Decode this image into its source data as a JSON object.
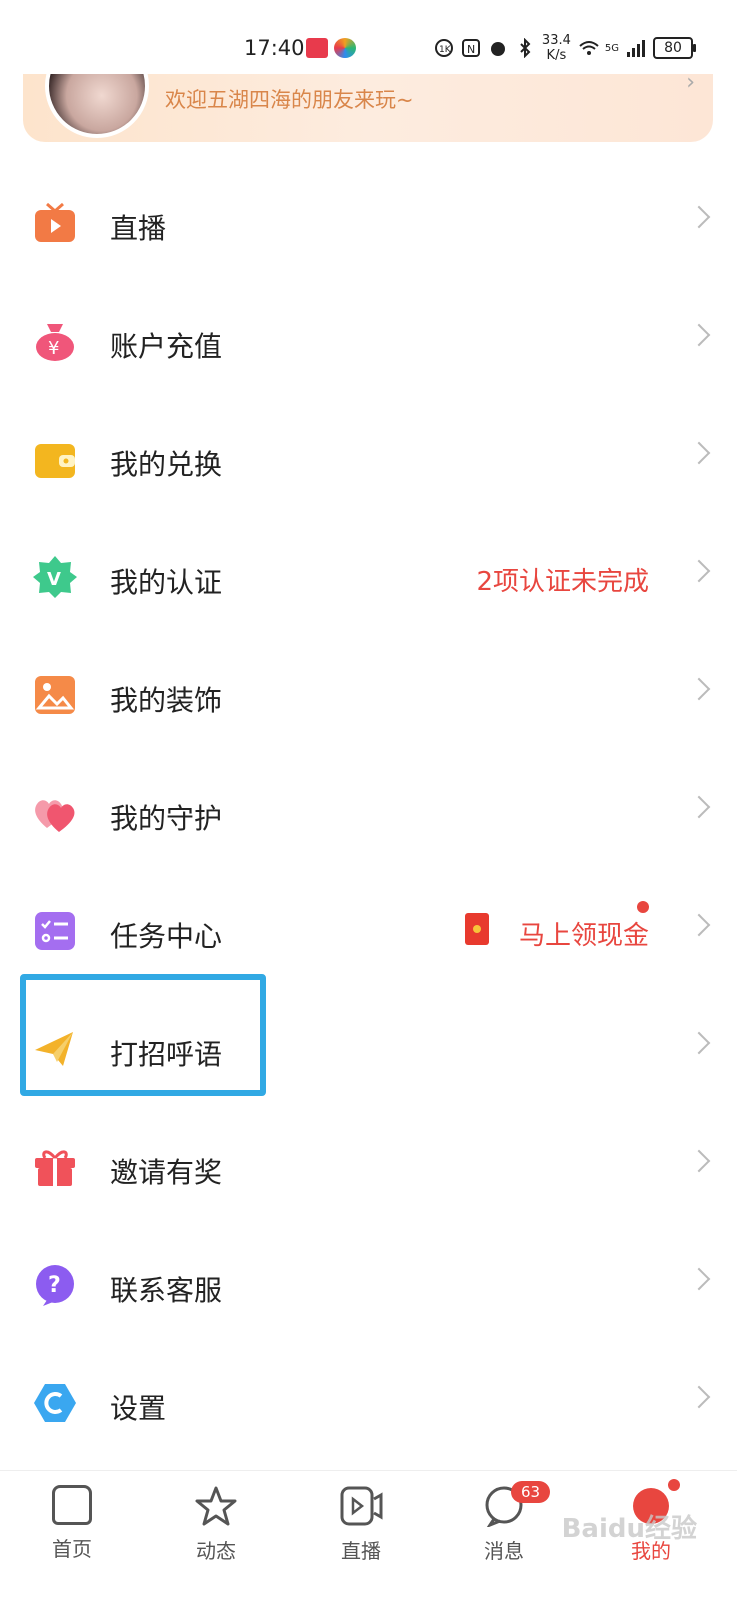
{
  "status": {
    "time": "17:40",
    "net_speed_value": "33.4",
    "net_speed_unit": "K/s",
    "signal": "5G",
    "battery": "80"
  },
  "profile": {
    "welcome": "欢迎五湖四海的朋友来玩~"
  },
  "menu": [
    {
      "label": "直播",
      "icon": "tv-icon",
      "color": "#f27a45"
    },
    {
      "label": "账户充值",
      "icon": "money-bag-icon",
      "color": "#f0567a"
    },
    {
      "label": "我的兑换",
      "icon": "wallet-icon",
      "color": "#f3b61f"
    },
    {
      "label": "我的认证",
      "icon": "verified-v-icon",
      "color": "#3ec98c",
      "extra": "2项认证未完成"
    },
    {
      "label": "我的装饰",
      "icon": "picture-icon",
      "color": "#f58a48"
    },
    {
      "label": "我的守护",
      "icon": "hearts-icon",
      "color": "#f0566f"
    },
    {
      "label": "任务中心",
      "icon": "task-list-icon",
      "color": "#a46ef0",
      "extra": "马上领现金"
    },
    {
      "label": "打招呼语",
      "icon": "paper-plane-icon",
      "color": "#f3b22a"
    },
    {
      "label": "邀请有奖",
      "icon": "gift-icon",
      "color": "#f0525a"
    },
    {
      "label": "联系客服",
      "icon": "question-icon",
      "color": "#8c5cf0"
    },
    {
      "label": "设置",
      "icon": "settings-hexagon-icon",
      "color": "#3aa7f0"
    }
  ],
  "tabs": [
    {
      "label": "首页",
      "icon": "home-icon"
    },
    {
      "label": "动态",
      "icon": "star-icon"
    },
    {
      "label": "直播",
      "icon": "live-video-icon"
    },
    {
      "label": "消息",
      "icon": "message-icon",
      "badge": "63"
    },
    {
      "label": "我的",
      "icon": "profile-icon",
      "active": true
    }
  ],
  "watermark": "Baidu经验",
  "accent": "#e8463f",
  "highlight_color": "#31a9e4"
}
